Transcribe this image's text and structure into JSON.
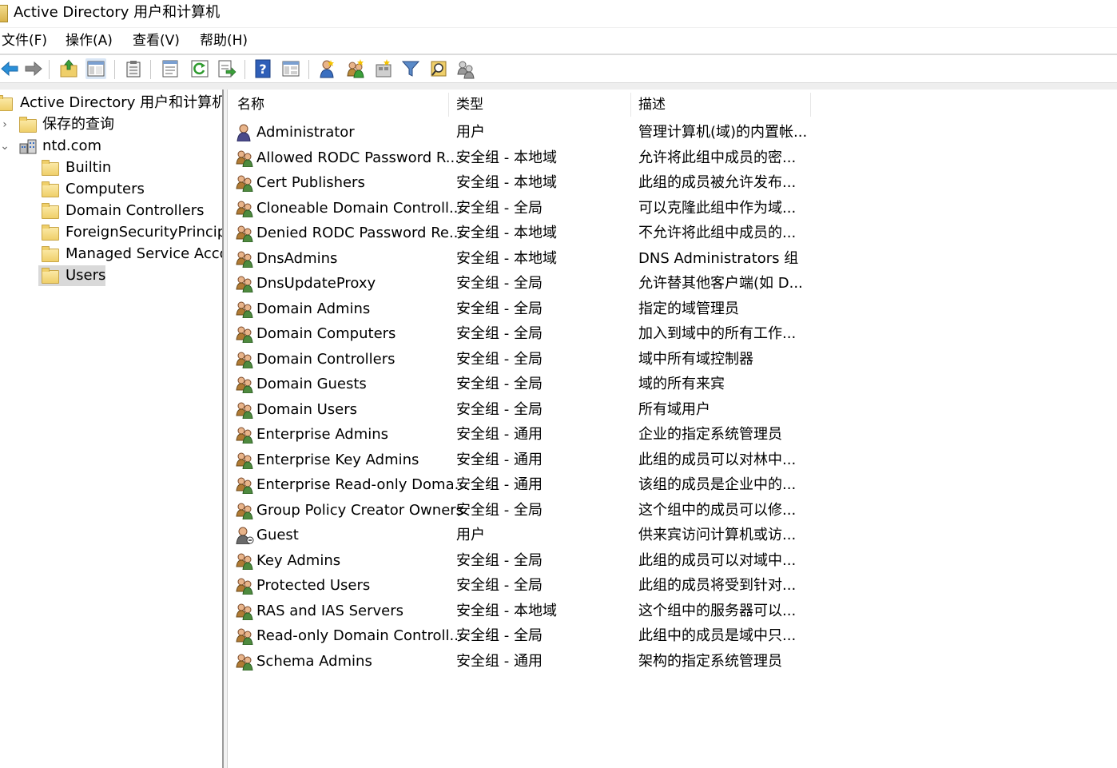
{
  "window": {
    "title": "Active Directory 用户和计算机"
  },
  "menu": [
    "文件(F)",
    "操作(A)",
    "查看(V)",
    "帮助(H)"
  ],
  "toolbar": {
    "buttons": [
      "back-arrow-icon",
      "forward-arrow-icon",
      "up-folder-icon",
      "console-tree-icon",
      "clipboard-icon",
      "properties-icon",
      "refresh-icon",
      "export-list-icon",
      "help-icon",
      "mmc-view-icon",
      "new-user-icon",
      "new-group-icon",
      "new-ou-icon",
      "filter-icon",
      "find-icon",
      "add-to-group-icon"
    ]
  },
  "tree": {
    "root": "Active Directory 用户和计算机 [",
    "saved_queries": "保存的查询",
    "domain": "ntd.com",
    "children": [
      "Builtin",
      "Computers",
      "Domain Controllers",
      "ForeignSecurityPrincipal",
      "Managed Service Accou",
      "Users"
    ],
    "selected": "Users"
  },
  "list": {
    "columns": [
      "名称",
      "类型",
      "描述"
    ],
    "rows": [
      {
        "name": "Administrator",
        "type": "用户",
        "desc": "管理计算机(域)的内置帐...",
        "kind": "user"
      },
      {
        "name": "Allowed RODC Password R...",
        "type": "安全组 - 本地域",
        "desc": "允许将此组中成员的密...",
        "kind": "group"
      },
      {
        "name": "Cert Publishers",
        "type": "安全组 - 本地域",
        "desc": "此组的成员被允许发布...",
        "kind": "group"
      },
      {
        "name": "Cloneable Domain Controll...",
        "type": "安全组 - 全局",
        "desc": "可以克隆此组中作为域...",
        "kind": "group"
      },
      {
        "name": "Denied RODC Password Re...",
        "type": "安全组 - 本地域",
        "desc": "不允许将此组中成员的...",
        "kind": "group"
      },
      {
        "name": "DnsAdmins",
        "type": "安全组 - 本地域",
        "desc": "DNS Administrators 组",
        "kind": "group"
      },
      {
        "name": "DnsUpdateProxy",
        "type": "安全组 - 全局",
        "desc": "允许替其他客户端(如 D...",
        "kind": "group"
      },
      {
        "name": "Domain Admins",
        "type": "安全组 - 全局",
        "desc": "指定的域管理员",
        "kind": "group"
      },
      {
        "name": "Domain Computers",
        "type": "安全组 - 全局",
        "desc": "加入到域中的所有工作...",
        "kind": "group"
      },
      {
        "name": "Domain Controllers",
        "type": "安全组 - 全局",
        "desc": "域中所有域控制器",
        "kind": "group"
      },
      {
        "name": "Domain Guests",
        "type": "安全组 - 全局",
        "desc": "域的所有来宾",
        "kind": "group"
      },
      {
        "name": "Domain Users",
        "type": "安全组 - 全局",
        "desc": "所有域用户",
        "kind": "group"
      },
      {
        "name": "Enterprise Admins",
        "type": "安全组 - 通用",
        "desc": "企业的指定系统管理员",
        "kind": "group"
      },
      {
        "name": "Enterprise Key Admins",
        "type": "安全组 - 通用",
        "desc": "此组的成员可以对林中...",
        "kind": "group"
      },
      {
        "name": "Enterprise Read-only Doma...",
        "type": "安全组 - 通用",
        "desc": "该组的成员是企业中的...",
        "kind": "group"
      },
      {
        "name": "Group Policy Creator Owners",
        "type": "安全组 - 全局",
        "desc": "这个组中的成员可以修...",
        "kind": "group"
      },
      {
        "name": "Guest",
        "type": "用户",
        "desc": "供来宾访问计算机或访...",
        "kind": "guest"
      },
      {
        "name": "Key Admins",
        "type": "安全组 - 全局",
        "desc": "此组的成员可以对域中...",
        "kind": "group"
      },
      {
        "name": "Protected Users",
        "type": "安全组 - 全局",
        "desc": "此组的成员将受到针对...",
        "kind": "group"
      },
      {
        "name": "RAS and IAS Servers",
        "type": "安全组 - 本地域",
        "desc": "这个组中的服务器可以...",
        "kind": "group"
      },
      {
        "name": "Read-only Domain Controll...",
        "type": "安全组 - 全局",
        "desc": "此组中的成员是域中只...",
        "kind": "group"
      },
      {
        "name": "Schema Admins",
        "type": "安全组 - 通用",
        "desc": "架构的指定系统管理员",
        "kind": "group"
      }
    ]
  }
}
